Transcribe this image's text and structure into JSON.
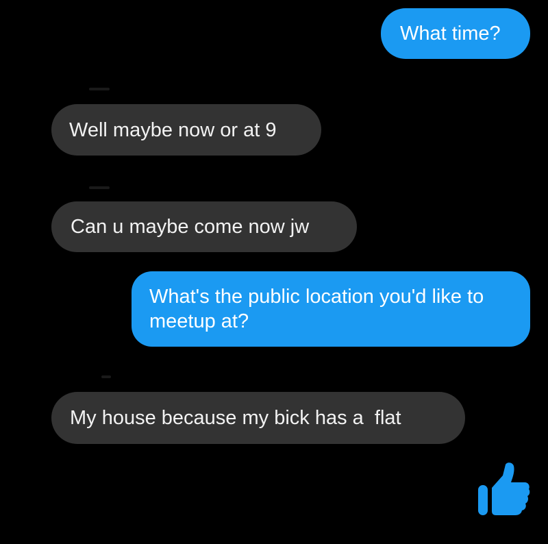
{
  "conversation": {
    "messages": [
      {
        "direction": "outgoing",
        "text": "What time?"
      },
      {
        "direction": "incoming",
        "text": "Well maybe now or at 9"
      },
      {
        "direction": "incoming",
        "text": "Can u maybe come now jw"
      },
      {
        "direction": "outgoing",
        "text": "What's the public location you'd like to meetup at?"
      },
      {
        "direction": "incoming",
        "text": "My house because my bick has a  flat"
      }
    ],
    "reaction": {
      "icon": "thumbs-up-icon",
      "color": "#1b9af2"
    }
  },
  "theme": {
    "background": "#000000",
    "incoming_bubble": "#333333",
    "outgoing_bubble": "#1b9af2"
  }
}
